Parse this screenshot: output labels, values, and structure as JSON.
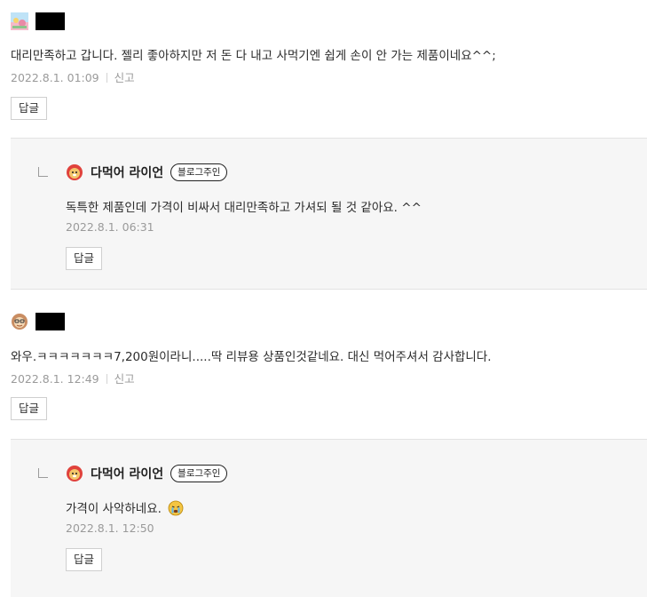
{
  "comments": [
    {
      "text": "대리만족하고 갑니다. 젤리 좋아하지만 저 돈 다 내고 사먹기엔 쉽게 손이 안 가는 제품이네요^^;",
      "date": "2022.8.1. 01:09",
      "report_label": "신고",
      "reply_button": "답글",
      "reply": {
        "author": "다먹어 라이언",
        "badge": "블로그주인",
        "text": "독특한 제품인데 가격이 비싸서 대리만족하고 가셔되 될 것 같아요. ^^",
        "date": "2022.8.1. 06:31",
        "reply_button": "답글"
      }
    },
    {
      "text": "와우.ㅋㅋㅋㅋㅋㅋㅋ7,200원이라니.....딱 리뷰용 상품인것같네요. 대신 먹어주셔서 감사합니다.",
      "date": "2022.8.1. 12:49",
      "report_label": "신고",
      "reply_button": "답글",
      "reply": {
        "author": "다먹어 라이언",
        "badge": "블로그주인",
        "text": "가격이 사악하네요.",
        "date": "2022.8.1. 12:50",
        "reply_button": "답글"
      }
    }
  ]
}
